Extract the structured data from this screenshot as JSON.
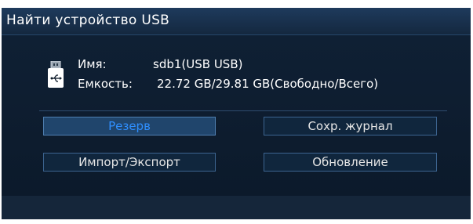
{
  "window": {
    "title": "Найти устройство USB"
  },
  "device": {
    "icon": "usb-drive-icon",
    "name_label": "Имя:",
    "name_value": "sdb1(USB USB)",
    "capacity_label": "Емкость:",
    "capacity_value": "22.72 GB/29.81 GB(Свободно/Всего)"
  },
  "buttons": {
    "backup": "Резерв",
    "save_log": "Сохр. журнал",
    "import_export": "Импорт/Экспорт",
    "update": "Обновление"
  },
  "colors": {
    "background": "#0d1b2a",
    "titlebar": "#1e3a5c",
    "accent_text": "#2f8fff",
    "button_border": "#3c6490"
  }
}
